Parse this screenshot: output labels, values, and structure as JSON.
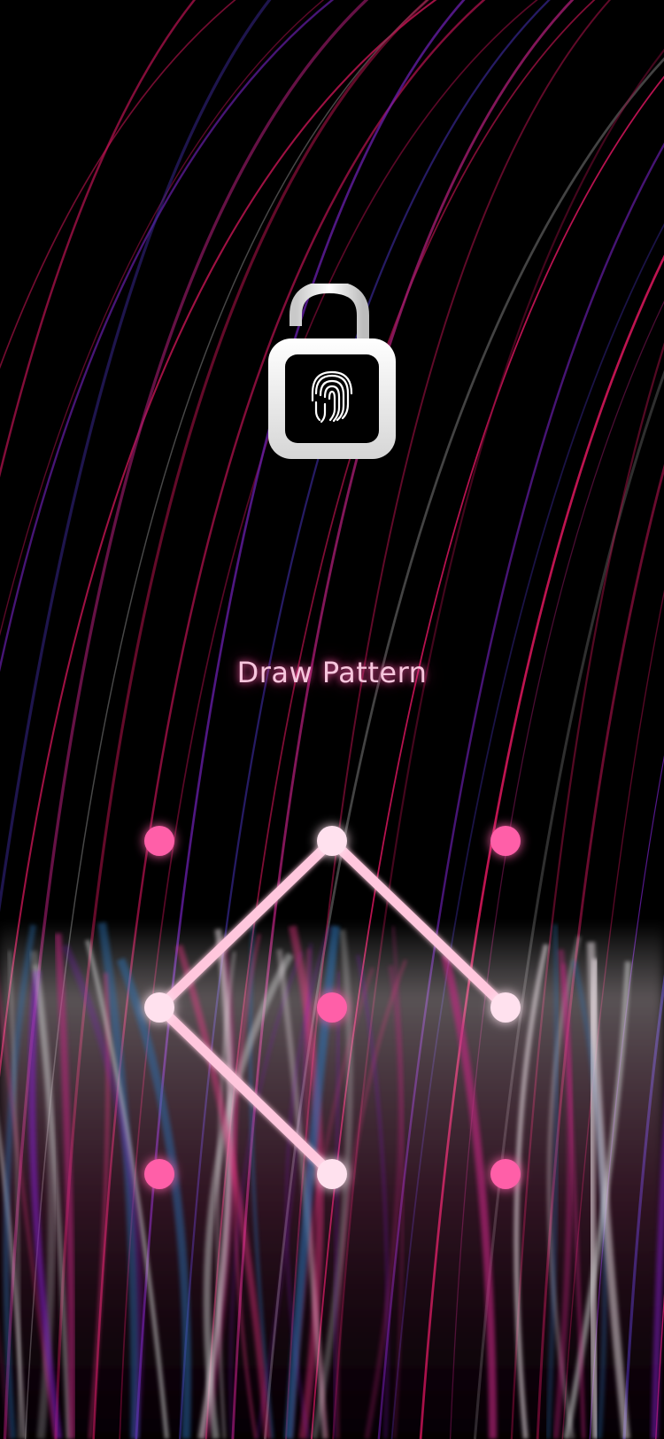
{
  "screen": {
    "prompt_text": "Draw Pattern"
  },
  "icons": {
    "lock": "unlocked-padlock-icon",
    "fingerprint": "fingerprint-icon"
  },
  "pattern": {
    "grid_size": 3,
    "selected_sequence": [
      5,
      1,
      3,
      7
    ],
    "dots": [
      {
        "index": 0,
        "row": 0,
        "col": 0,
        "selected": false
      },
      {
        "index": 1,
        "row": 0,
        "col": 1,
        "selected": true
      },
      {
        "index": 2,
        "row": 0,
        "col": 2,
        "selected": false
      },
      {
        "index": 3,
        "row": 1,
        "col": 0,
        "selected": true
      },
      {
        "index": 4,
        "row": 1,
        "col": 1,
        "selected": false
      },
      {
        "index": 5,
        "row": 1,
        "col": 2,
        "selected": true
      },
      {
        "index": 6,
        "row": 2,
        "col": 0,
        "selected": false
      },
      {
        "index": 7,
        "row": 2,
        "col": 1,
        "selected": true
      },
      {
        "index": 8,
        "row": 2,
        "col": 2,
        "selected": false
      }
    ]
  },
  "colors": {
    "background": "#000000",
    "dot_idle": "#ff5fa8",
    "dot_selected": "#ffe1ee",
    "pattern_line": "#ffc7dd",
    "prompt_text": "#f7c6dd",
    "lock_body": "#ffffff"
  }
}
